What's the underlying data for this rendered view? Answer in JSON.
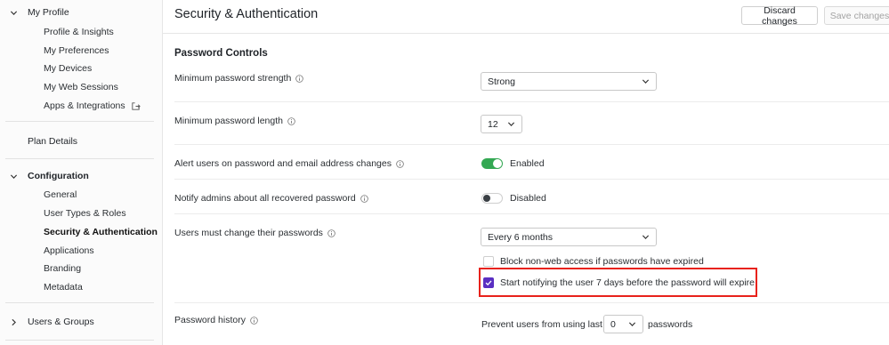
{
  "sidebar": {
    "my_profile": "My Profile",
    "profile_items": [
      {
        "label": "Profile & Insights"
      },
      {
        "label": "My Preferences"
      },
      {
        "label": "My Devices"
      },
      {
        "label": "My Web Sessions"
      },
      {
        "label": "Apps & Integrations"
      }
    ],
    "plan_details": "Plan Details",
    "configuration": "Configuration",
    "config_items": [
      {
        "label": "General"
      },
      {
        "label": "User Types & Roles"
      },
      {
        "label": "Security & Authentication"
      },
      {
        "label": "Applications"
      },
      {
        "label": "Branding"
      },
      {
        "label": "Metadata"
      }
    ],
    "users_groups": "Users & Groups"
  },
  "header": {
    "title": "Security & Authentication",
    "discard_label": "Discard changes",
    "save_label": "Save changes"
  },
  "main": {
    "section_title": "Password Controls",
    "min_strength_label": "Minimum password strength",
    "min_strength_value": "Strong",
    "min_length_label": "Minimum password length",
    "min_length_value": "12",
    "alert_label": "Alert users on password and email address changes",
    "alert_state": "Enabled",
    "notify_admins_label": "Notify admins about all recovered password",
    "notify_admins_state": "Disabled",
    "change_label": "Users must change their passwords",
    "change_value": "Every 6 months",
    "block_label": "Block non-web access if passwords have expired",
    "notify_user_label": "Start notifying the user 7 days before the password will expire",
    "history_label": "Password history",
    "history_prefix": "Prevent users from using last",
    "history_value": "0",
    "history_suffix": "passwords"
  },
  "colors": {
    "toggle_on": "#34a853",
    "checkbox_checked": "#5a2fc2",
    "highlight_box": "#e8221b"
  },
  "icons": [
    "chevron-down-icon",
    "chevron-right-icon",
    "external-link-icon",
    "info-icon",
    "check-icon"
  ]
}
